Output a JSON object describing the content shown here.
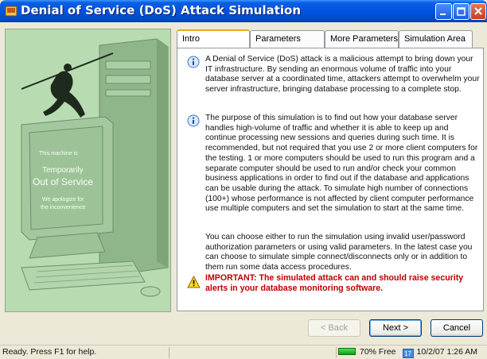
{
  "window": {
    "title": "Denial of Service (DoS) Attack Simulation",
    "icon": "app-icon"
  },
  "art": {
    "screen_line1": "This machine is",
    "screen_line2": "Temporarily",
    "screen_line3": "Out of Service",
    "screen_line4": "We apologize for",
    "screen_line5": "the inconvenience"
  },
  "tabs": [
    {
      "label": "Intro",
      "active": true
    },
    {
      "label": "Parameters",
      "active": false
    },
    {
      "label": "More Parameters",
      "active": false
    },
    {
      "label": "Simulation Area",
      "active": false
    }
  ],
  "intro": {
    "p1": "A Denial of Service (DoS) attack is a malicious attempt to bring down your IT infrastructure. By sending an enormous volume of traffic into your database server at a coordinated time, attackers attempt to overwhelm your server infrastructure, bringing database processing to a complete stop.",
    "p2": "The purpose of this simulation is to find out how your database server handles high-volume of traffic and whether it is able to keep up and continue processing new sessions and queries during such time. It is recommended, but not required that you use 2 or more client computers for the testing. 1 or more computers should be used to run this program and a separate computer should be used to run and/or check your common business applications in order to find out if the database and applications can be usable during the attack. To simulate high number of connections (100+) whose performance is not affected by client computer performance use multiple computers and set the simulation to start at the same time.",
    "p3": "You can choose either to run the simulation using invalid user/password authorization parameters or using valid parameters. In the latest case you can choose to simulate simple connect/disconnects only or in addition to them run some data access procedures.",
    "important": "IMPORTANT: The simulated attack can and should raise security alerts in your database monitoring software."
  },
  "buttons": {
    "back": "< Back",
    "next": "Next >",
    "cancel": "Cancel"
  },
  "status": {
    "ready": "Ready. Press F1 for help.",
    "memory": "70% Free",
    "calendar_day": "17",
    "datetime": "10/2/07 1:26 AM"
  },
  "colors": {
    "titlebar": "#0053e0",
    "important": "#c00000",
    "art_bg": "#b9dbb1"
  }
}
